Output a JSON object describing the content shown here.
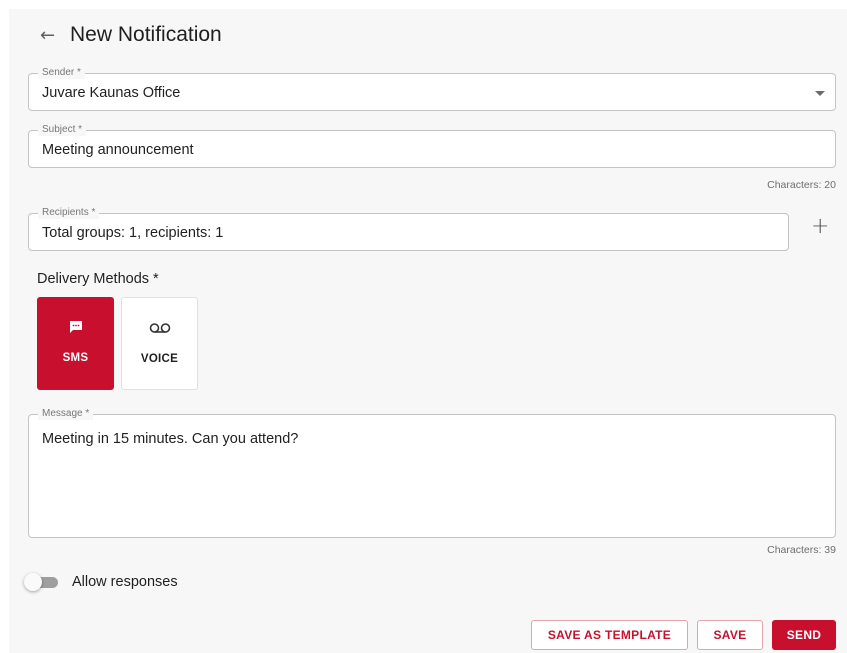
{
  "header": {
    "back_icon": "arrow-left-icon",
    "title": "New Notification"
  },
  "sender": {
    "label": "Sender *",
    "value": "Juvare Kaunas Office"
  },
  "subject": {
    "label": "Subject *",
    "value": "Meeting announcement",
    "counter": "Characters: 20"
  },
  "recipients": {
    "label": "Recipients *",
    "value": "Total groups: 1, recipients: 1",
    "add_icon": "plus-icon"
  },
  "delivery": {
    "label": "Delivery Methods *",
    "methods": [
      {
        "label": "SMS",
        "icon": "message-icon",
        "selected": true
      },
      {
        "label": "VOICE",
        "icon": "voicemail-icon",
        "selected": false
      }
    ]
  },
  "message": {
    "label": "Message *",
    "value": "Meeting in 15 minutes. Can you attend?",
    "counter": "Characters: 39"
  },
  "allow_responses": {
    "label": "Allow responses",
    "enabled": false
  },
  "buttons": {
    "save_template": "SAVE AS TEMPLATE",
    "save": "SAVE",
    "send": "SEND"
  },
  "colors": {
    "accent": "#c8102e",
    "background": "#f7f7f7"
  }
}
